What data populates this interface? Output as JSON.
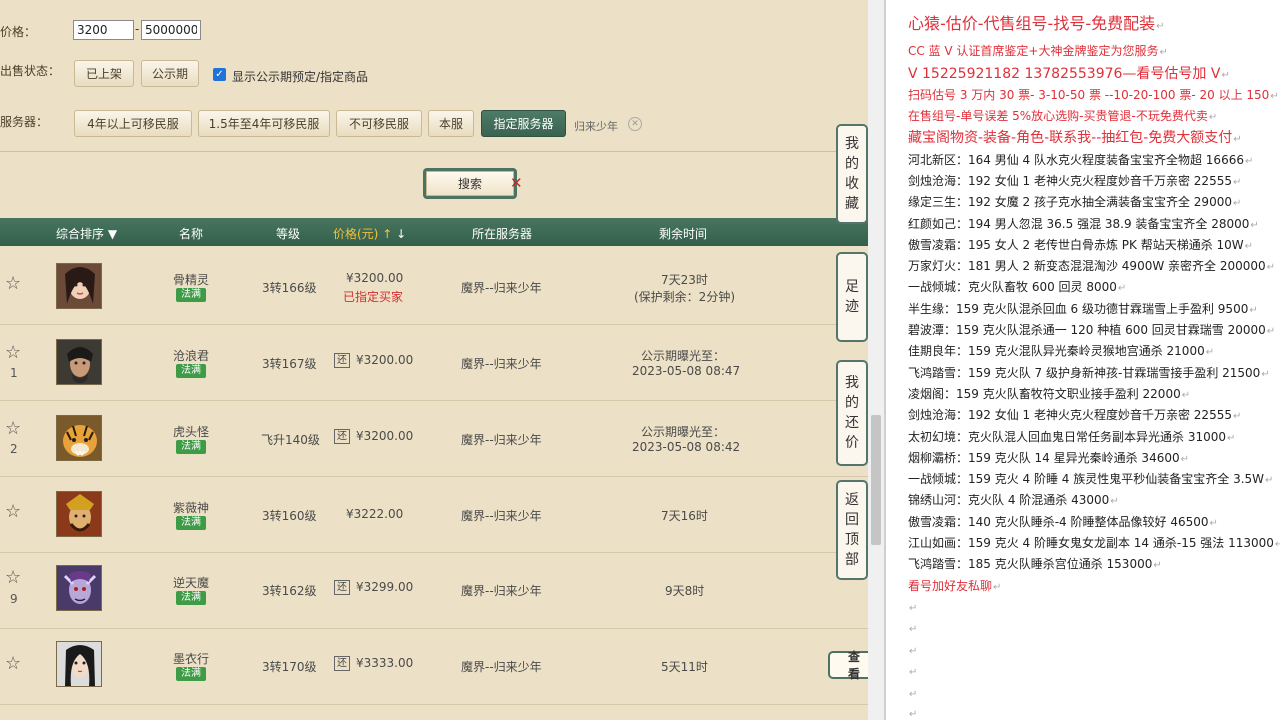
{
  "filters": {
    "price_label": "价格：",
    "price_min": "3200",
    "price_max": "5000000",
    "sale_status_label": "出售状态：",
    "on_shelf": "已上架",
    "public_period": "公示期",
    "show_reserved": "显示公示期预定/指定商品",
    "server_label": "服务器：",
    "server_buttons": [
      "4年以上可移民服",
      "1.5年至4年可移民服",
      "不可移民服",
      "本服",
      "指定服务器"
    ],
    "selected_server": "归来少年",
    "search": "搜索"
  },
  "table": {
    "headers": [
      "综合排序",
      "名称",
      "等级",
      "价格(元)",
      "所在服务器",
      "剩余时间"
    ],
    "rows": [
      {
        "rank": "",
        "name": "骨精灵",
        "school": "法满",
        "level": "3转166级",
        "price": "¥3200.00",
        "note": "已指定买家",
        "bargain": "",
        "server": "魔界--归来少年",
        "time1": "7天23时",
        "time2": "(保护剩余：2分钟)"
      },
      {
        "rank": "1",
        "name": "沧浪君",
        "school": "法满",
        "level": "3转167级",
        "price": "¥3200.00",
        "note": "",
        "bargain": "还",
        "server": "魔界--归来少年",
        "time1": "公示期曝光至：",
        "time2": "2023-05-08 08:47"
      },
      {
        "rank": "2",
        "name": "虎头怪",
        "school": "法满",
        "level": "飞升140级",
        "price": "¥3200.00",
        "note": "",
        "bargain": "还",
        "server": "魔界--归来少年",
        "time1": "公示期曝光至：",
        "time2": "2023-05-08 08:42"
      },
      {
        "rank": "",
        "name": "紫薇神",
        "school": "法满",
        "level": "3转160级",
        "price": "¥3222.00",
        "note": "",
        "bargain": "",
        "server": "魔界--归来少年",
        "time1": "7天16时",
        "time2": ""
      },
      {
        "rank": "9",
        "name": "逆天魔",
        "school": "法满",
        "level": "3转162级",
        "price": "¥3299.00",
        "note": "",
        "bargain": "还",
        "server": "魔界--归来少年",
        "time1": "9天8时",
        "time2": ""
      },
      {
        "rank": "",
        "name": "墨衣行",
        "school": "法满",
        "level": "3转170级",
        "price": "¥3333.00",
        "note": "",
        "bargain": "还",
        "server": "魔界--归来少年",
        "time1": "5天11时",
        "time2": ""
      }
    ]
  },
  "side_tabs": {
    "favorites": [
      "我",
      "的",
      "收",
      "藏"
    ],
    "footprints": [
      "足",
      "迹"
    ],
    "my_offers": [
      "我",
      "的",
      "还",
      "价"
    ],
    "back_top": [
      "返",
      "回",
      "顶",
      "部"
    ],
    "view_label": "查看"
  },
  "notes": {
    "title": "心猿-估价-代售组号-找号-免费配装",
    "lines": [
      "CC 蓝 V 认证首席鉴定+大神金牌鉴定为您服务",
      "V 15225921182      13782553976—看号估号加 V",
      "扫码估号 3 万内 30 票- 3-10-50 票 --10-20-100 票- 20 以上 150",
      "在售组号-单号误差 5%放心选购-买贵管退-不玩免费代卖",
      "藏宝阁物资-装备-角色-联系我--抽红包-免费大额支付",
      "河北新区：164 男仙 4 队水克火程度装备宝宝齐全物超 16666",
      "剑烛沧海：192 女仙 1 老神火克火程度妙音千万亲密 22555",
      "缘定三生：192 女魔 2 孩子克水抽全满装备宝宝齐全 29000",
      "红颜如己：194 男人忽混 36.5 强混 38.9 装备宝宝齐全 28000",
      "傲雪凌霜：195 女人 2 老传世白骨赤炼 PK 帮站天梯通杀 10W",
      "万家灯火：181 男人 2 新变态混混淘沙 4900W 亲密齐全 200000",
      "一战倾城：克火队畜牧 600 回灵 8000",
      "半生缘：159 克火队混杀回血 6 级功德甘霖瑞雪上手盈利 9500",
      "碧波潭：159 克火队混杀通一 120 种植 600 回灵甘霖瑞雪 20000",
      "佳期良年：159 克火混队异光秦岭灵猴地宫通杀 21000",
      "飞鸿踏雪：159 克火队 7 级护身新神孩-甘霖瑞雪接手盈利 21500",
      "凌烟阁：159 克火队畜牧符文职业接手盈利 22000",
      "剑烛沧海：192 女仙 1 老神火克火程度妙音千万亲密 22555",
      "太初幻境：克火队混人回血鬼日常任务副本异光通杀 31000",
      "烟柳灞桥：159 克火队 14 星异光秦岭通杀 34600",
      "一战倾城：159 克火 4 阶睡 4 族灵性鬼平秒仙装备宝宝齐全 3.5W",
      "锦绣山河：克火队 4 阶混通杀 43000",
      "傲雪凌霜：140 克火队睡杀-4 阶睡整体品像较好 46500",
      "江山如画：159 克火 4 阶睡女鬼女龙副本 14 通杀-15 强法 113000",
      "飞鸿踏雪：185 克火队睡杀宫位通杀 153000"
    ],
    "footer": "看号加好友私聊"
  }
}
